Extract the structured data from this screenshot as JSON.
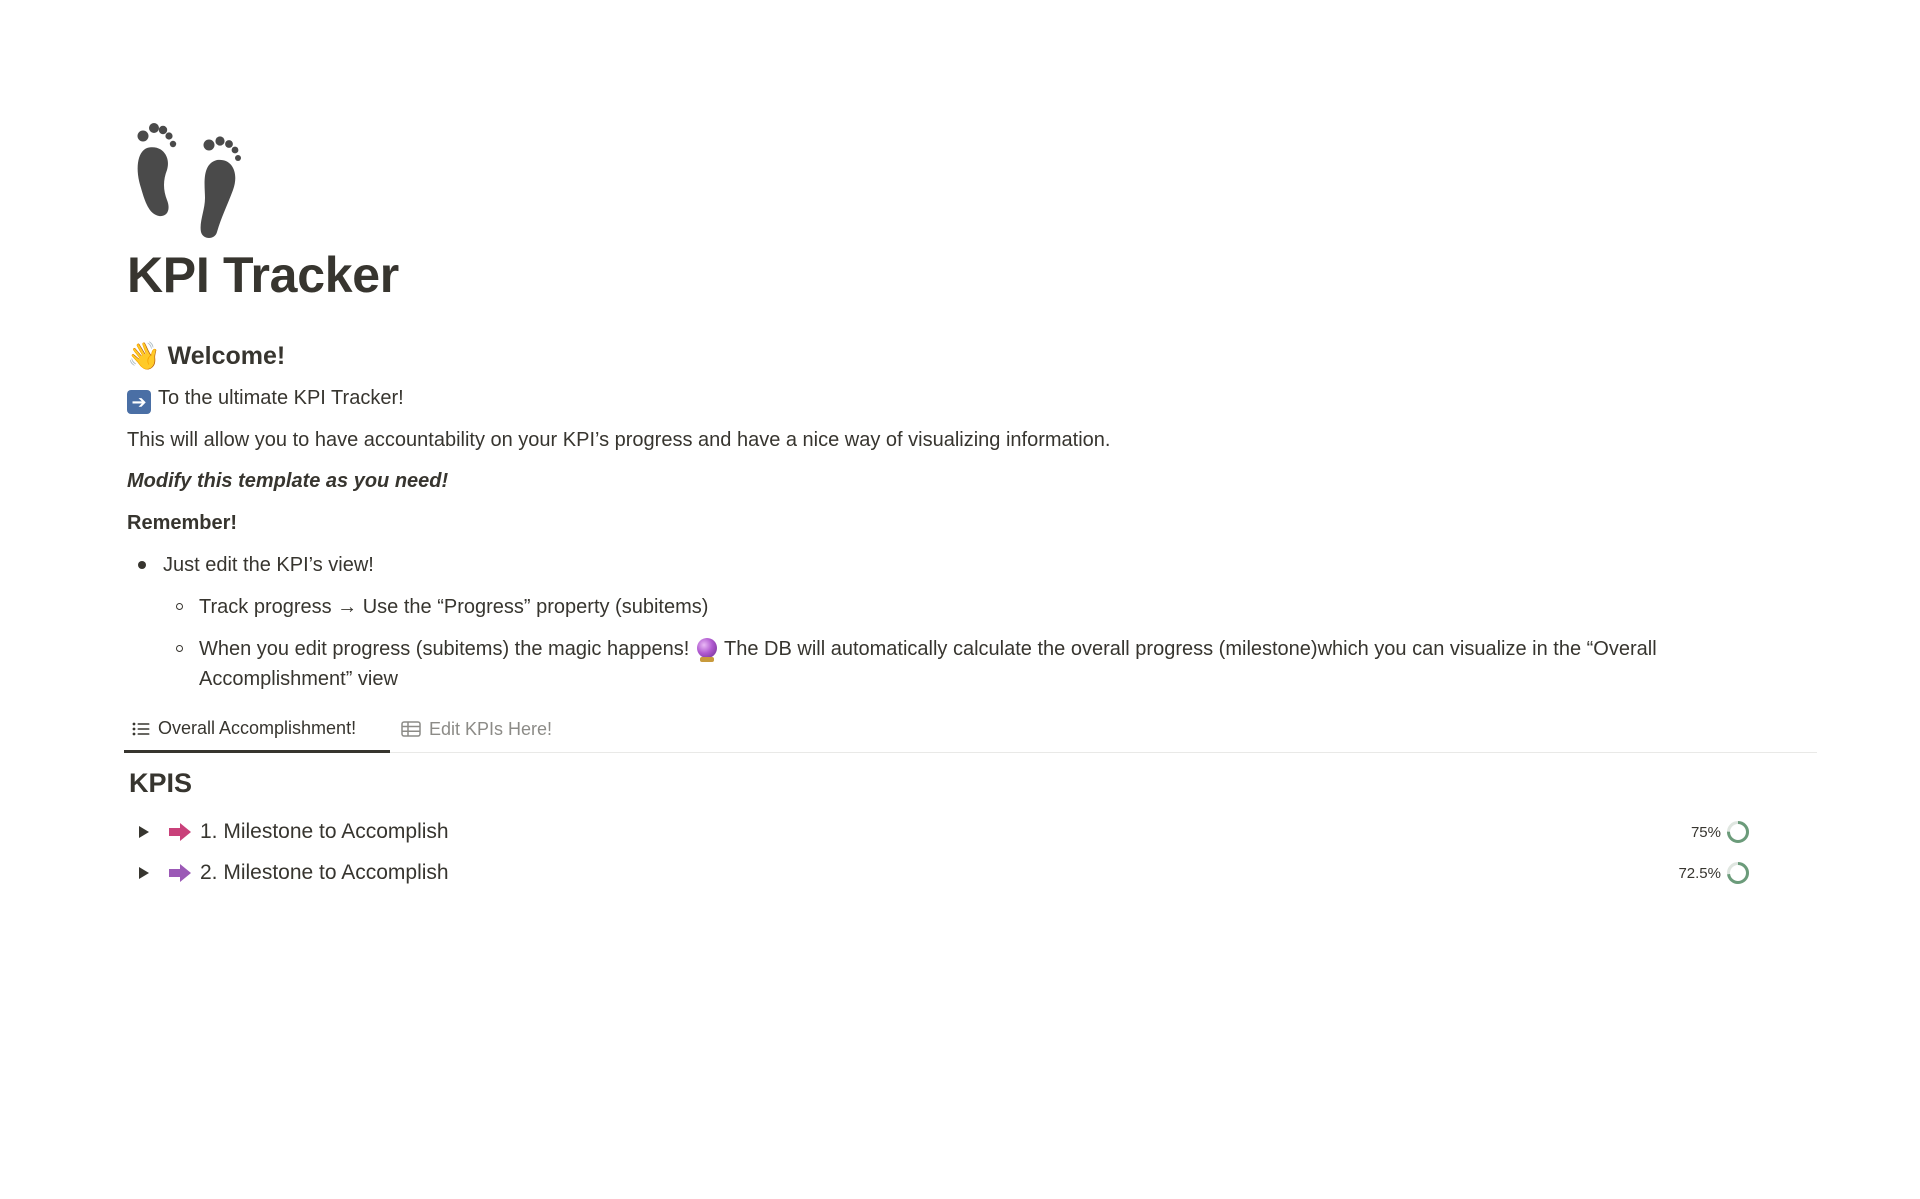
{
  "page": {
    "icon": "footprints-icon",
    "title": "KPI Tracker"
  },
  "welcome": {
    "heading": "Welcome!",
    "heading_icon": "waving-hand-icon",
    "intro_icon": "right-arrow-icon",
    "intro": "To the ultimate KPI Tracker!",
    "description": "This will allow you to have accountability on your KPI’s progress and have a nice way of visualizing information.",
    "modify_note": "Modify this template as you need!",
    "remember": "Remember!",
    "bullet_1": "Just edit the KPI’s view!",
    "sub_bullet_1": "Track progress → Use the “Progress” property (subitems)",
    "sub_bullet_2_part1": "When you edit progress (subitems) the magic happens!",
    "sub_bullet_2_icon": "crystal-ball-icon",
    "sub_bullet_2_part2": "The DB will automatically calculate the overall progress (milestone)which you can visualize in the “Overall Accomplishment” view"
  },
  "tabs": [
    {
      "label": "Overall Accomplishment!",
      "icon": "list-icon",
      "active": true
    },
    {
      "label": "Edit KPIs Here!",
      "icon": "table-icon",
      "active": false
    }
  ],
  "database": {
    "title": "KPIS",
    "rows": [
      {
        "label": "1. Milestone to Accomplish",
        "progress_text": "75%",
        "progress": 0.75,
        "arrow_color": "#c9417a"
      },
      {
        "label": "2. Milestone to Accomplish",
        "progress_text": "72.5%",
        "progress": 0.725,
        "arrow_color": "#9b59b6"
      }
    ]
  },
  "colors": {
    "text": "#37352f",
    "muted": "#8c8b87",
    "progress_ring": "#6b9b7a",
    "progress_track": "#dfe6e0"
  }
}
